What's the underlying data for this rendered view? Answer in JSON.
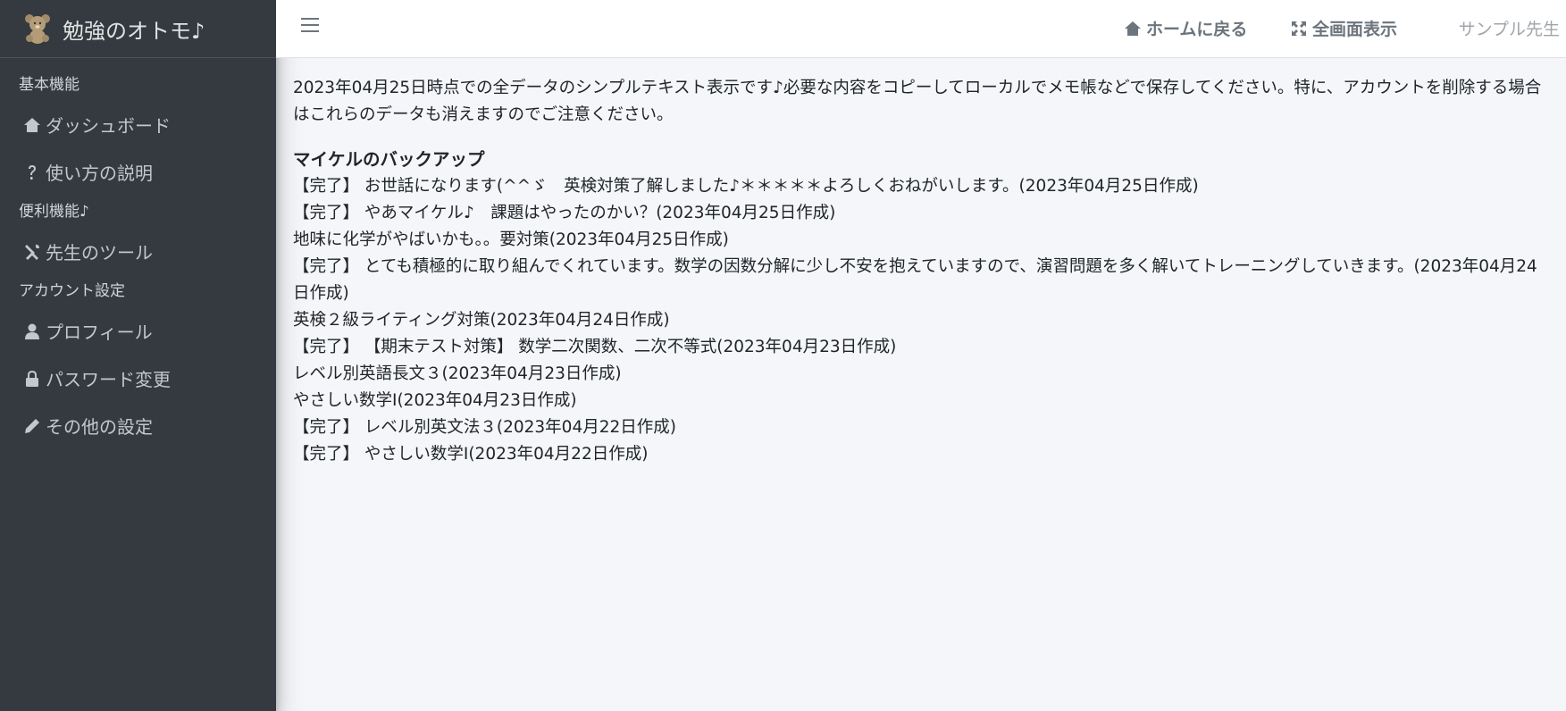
{
  "brand": {
    "title": "勉強のオトモ♪",
    "logo_icon": "teddy-bear-icon"
  },
  "sidebar": {
    "sections": [
      {
        "header": "基本機能",
        "items": [
          {
            "label": "ダッシュボード",
            "icon": "home-icon"
          },
          {
            "label": "使い方の説明",
            "icon": "question-icon"
          }
        ]
      },
      {
        "header": "便利機能♪",
        "items": [
          {
            "label": "先生のツール",
            "icon": "tools-icon"
          }
        ]
      },
      {
        "header": "アカウント設定",
        "items": [
          {
            "label": "プロフィール",
            "icon": "user-icon"
          },
          {
            "label": "パスワード変更",
            "icon": "lock-icon"
          },
          {
            "label": "その他の設定",
            "icon": "pencil-icon"
          }
        ]
      }
    ]
  },
  "topbar": {
    "home_link": "ホームに戻る",
    "fullscreen_link": "全画面表示",
    "user_name": "サンプル先生"
  },
  "content": {
    "intro": "2023年04月25日時点での全データのシンプルテキスト表示です♪必要な内容をコピーしてローカルでメモ帳などで保存してください。特に、アカウントを削除する場合はこれらのデータも消えますのでご注意ください。",
    "backup_title": "マイケルのバックアップ",
    "entries": [
      "【完了】 お世話になります(^^ゞ　英検対策了解しました♪＊＊＊＊＊よろしくおねがいします。(2023年04月25日作成)",
      "【完了】 やあマイケル♪　課題はやったのかい？(2023年04月25日作成)",
      "地味に化学がやばいかも。。要対策(2023年04月25日作成)",
      "【完了】 とても積極的に取り組んでくれています。数学の因数分解に少し不安を抱えていますので、演習問題を多く解いてトレーニングしていきます。(2023年04月24日作成)",
      "英検２級ライティング対策(2023年04月24日作成)",
      "【完了】 【期末テスト対策】 数学二次関数、二次不等式(2023年04月23日作成)",
      "レベル別英語長文３(2023年04月23日作成)",
      "やさしい数学Ⅰ(2023年04月23日作成)",
      "【完了】 レベル別英文法３(2023年04月22日作成)",
      "【完了】 やさしい数学Ⅰ(2023年04月22日作成)"
    ]
  }
}
